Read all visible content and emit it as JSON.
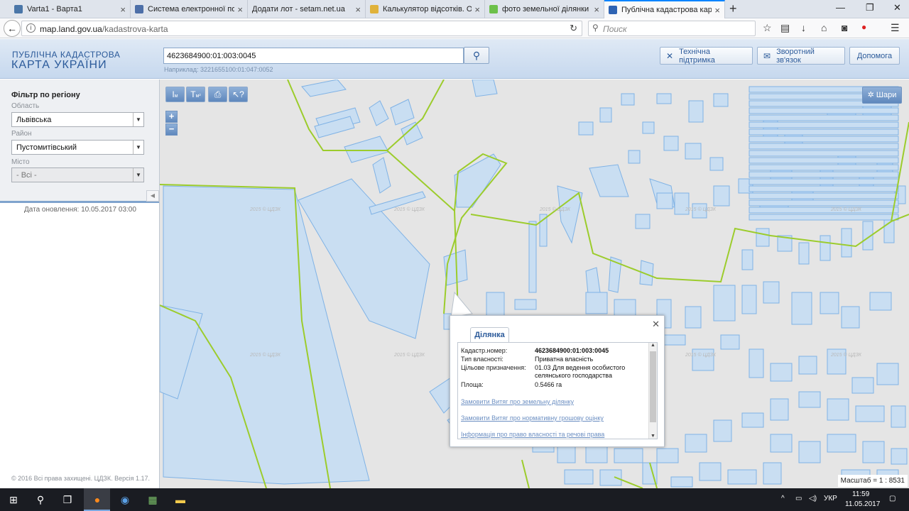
{
  "browser": {
    "tabs": [
      {
        "title": "Varta1 - Варта1",
        "color": "#4a76a8"
      },
      {
        "title": "Система електронної пошт",
        "color": "#4d6fa8"
      },
      {
        "title": "Додати лот - setam.net.ua",
        "color": "#ffffff"
      },
      {
        "title": "Калькулятор відсотків. Онл",
        "color": "#e0b23a"
      },
      {
        "title": "фото земельної ділянки бо",
        "color": "#6cc04a"
      },
      {
        "title": "Публічна кадастрова карта",
        "color": "#2e63b3"
      }
    ],
    "url_host": "map.land.gov.ua",
    "url_path": "/kadastrova-karta",
    "search_placeholder": "Поиск"
  },
  "header": {
    "logo_line1": "ПУБЛІЧНА КАДАСТРОВА",
    "logo_line2": "КАРТА УКРАЇНИ",
    "query_value": "4623684900:01:003:0045",
    "example": "Наприклад: 3221655100:01:047:0052",
    "support_label": "Технічна підтримка",
    "feedback_label": "Зворотний зв'язок",
    "help_label": "Допомога"
  },
  "filter": {
    "title": "Фільтр по регіону",
    "oblast_label": "Область",
    "oblast_value": "Львівська",
    "rayon_label": "Район",
    "rayon_value": "Пустомитівський",
    "city_label": "Місто",
    "city_value": "- Всі -",
    "update": "Дата оновлення: 10.05.2017 03:00",
    "copyright": "© 2016 Всі права захищені. ЦДЗК. Версія 1.17."
  },
  "map": {
    "layers_label": "Шари",
    "scale": "Масштаб = 1 : 8531",
    "watermark": "2015 © ЦДЗК",
    "parcel_fill": "#c9def2",
    "parcel_stroke": "#7fb2e5",
    "border_color": "#9ccc2c"
  },
  "popup": {
    "tab": "Ділянка",
    "rows": [
      {
        "k": "Кадастр.номер:",
        "v": "4623684900:01:003:0045"
      },
      {
        "k": "Тип власності:",
        "v": "Приватна власність"
      },
      {
        "k": "Цільове призначення:",
        "v": "01.03 Для ведення особистого селянського господарства"
      },
      {
        "k": "Площа:",
        "v": "0.5466 га"
      }
    ],
    "links": [
      "Замовити Витяг про земельну ділянку",
      "Замовити Витяг про нормативну грошову оцінку",
      "Інформація про право власності та речові права"
    ]
  },
  "taskbar": {
    "lang": "УКР",
    "time": "11:59",
    "date": "11.05.2017"
  }
}
